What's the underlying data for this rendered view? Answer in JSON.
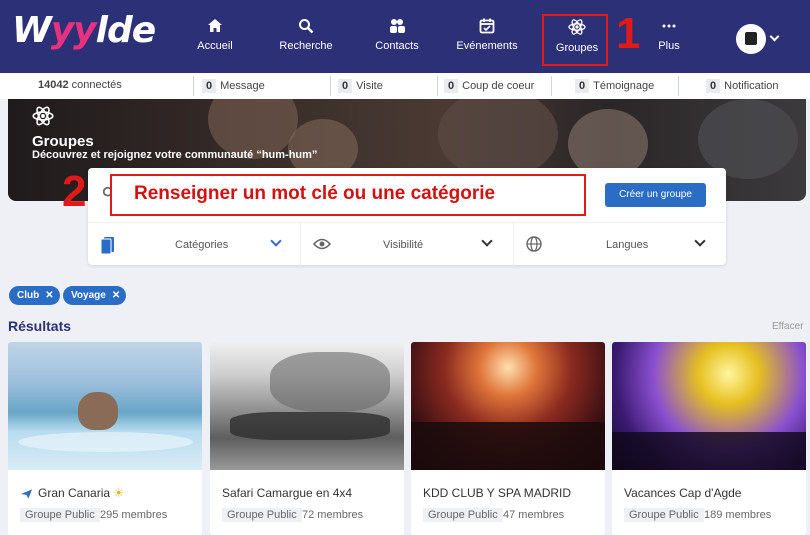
{
  "brand": {
    "logo_part1": "W",
    "logo_part2": "yy",
    "logo_part3": "lde"
  },
  "nav": {
    "accueil": "Accueil",
    "recherche": "Recherche",
    "contacts": "Contacts",
    "evenements": "Evénements",
    "groupes": "Groupes",
    "plus": "Plus"
  },
  "annotations": {
    "one": "1",
    "two": "2"
  },
  "status": {
    "connected_count": "14042",
    "connected_label": "connectés",
    "message_count": "0",
    "message_label": "Message",
    "visite_count": "0",
    "visite_label": "Visite",
    "coeur_count": "0",
    "coeur_label": "Coup de coeur",
    "temoignage_count": "0",
    "temoignage_label": "Témoignage",
    "notification_count": "0",
    "notification_label": "Notification"
  },
  "hero": {
    "title": "Groupes",
    "subtitle": "Découvrez et rejoignez votre communauté “hum-hum”"
  },
  "search": {
    "annotation_text": "Renseigner un mot clé ou une catégorie",
    "create_button": "Créer un groupe"
  },
  "filters": {
    "categories": "Catégories",
    "visibilite": "Visibilité",
    "langues": "Langues"
  },
  "tags": [
    "Club",
    "Voyage"
  ],
  "results": {
    "title": "Résultats",
    "clear": "Effacer"
  },
  "cards": [
    {
      "name": "Gran Canaria",
      "badge": "Groupe Public",
      "members": "295 membres"
    },
    {
      "name": "Safari Camargue en 4x4",
      "badge": "Groupe Public",
      "members": "72 membres"
    },
    {
      "name": "KDD CLUB Y SPA MADRID",
      "badge": "Groupe Public",
      "members": "47 membres"
    },
    {
      "name": "Vacances Cap d'Agde",
      "badge": "Groupe Public",
      "members": "189 membres"
    }
  ],
  "colors": {
    "nav_bg": "#2c3077",
    "accent": "#2b6cc4",
    "logo_pink": "#e8327f",
    "annotation_red": "#e01919"
  }
}
